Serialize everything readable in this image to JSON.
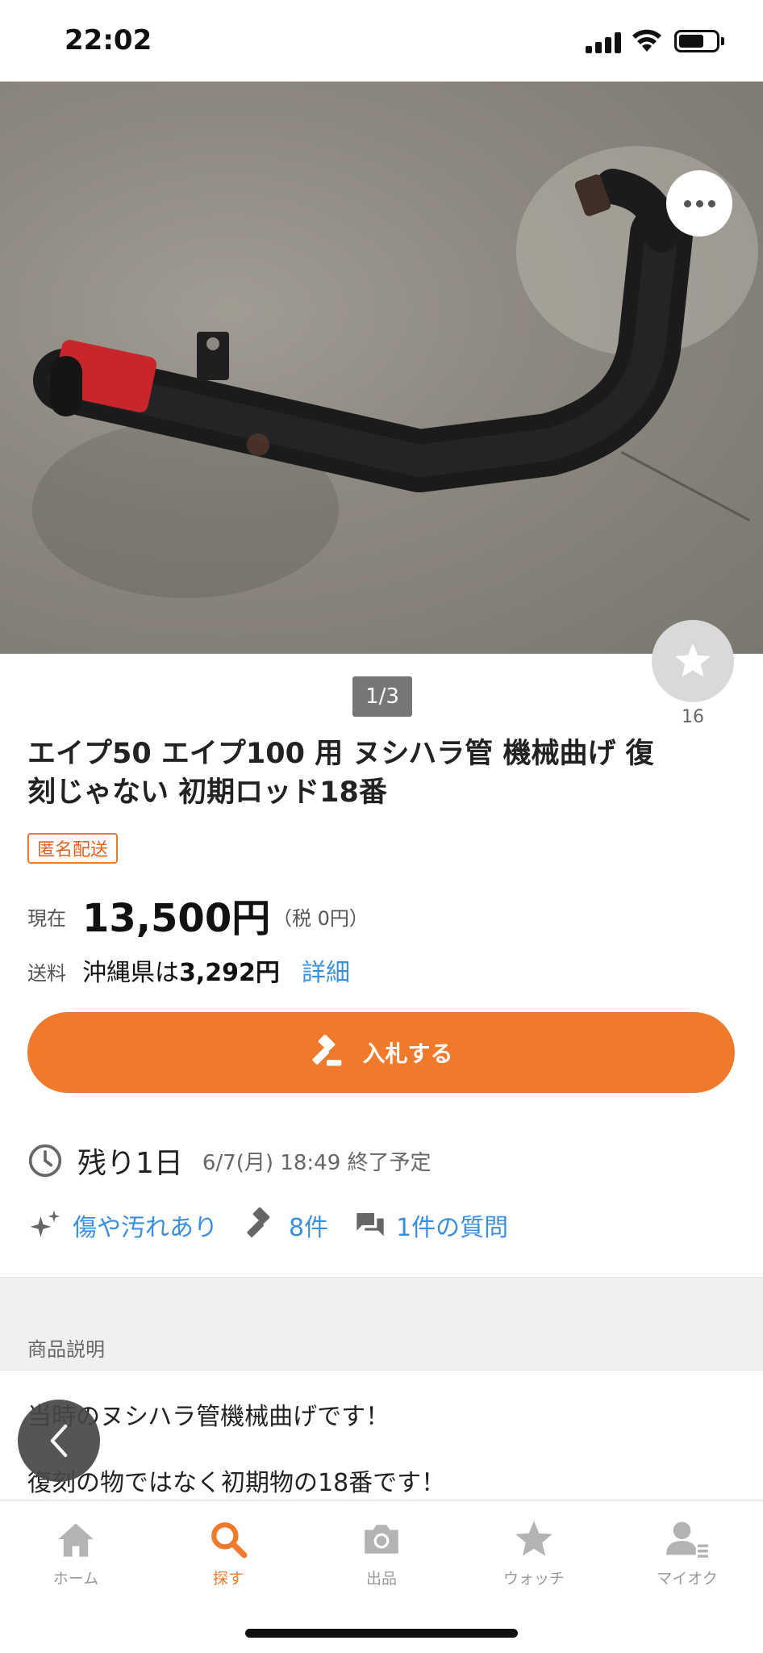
{
  "status": {
    "time": "22:02"
  },
  "photo": {
    "alt": "",
    "page_counter": "1/3"
  },
  "watch": {
    "count": "16"
  },
  "item": {
    "title": "エイプ50 エイプ100 用 ヌシハラ管 機械曲げ 復刻じゃない 初期ロッド18番",
    "badge": "匿名配送",
    "price_label": "現在",
    "price": "13,500円",
    "tax": "（税 0円）",
    "ship_label": "送料",
    "ship_prefix": "沖縄県は",
    "ship_price": "3,292円",
    "ship_detail": "詳細"
  },
  "bid_button": {
    "label": "入札する"
  },
  "remaining": {
    "text": "残り1日",
    "end": "6/7(月) 18:49 終了予定"
  },
  "info": {
    "condition": "傷や汚れあり",
    "bids": "8件",
    "questions": "1件の質問"
  },
  "description": {
    "section_title": "商品説明",
    "line1": "当時のヌシハラ管機械曲げです！",
    "line2": "復刻の物ではなく初期物の18番です！"
  },
  "tabs": [
    {
      "label": "ホーム",
      "icon": "home-icon"
    },
    {
      "label": "探す",
      "icon": "search-icon"
    },
    {
      "label": "出品",
      "icon": "camera-icon"
    },
    {
      "label": "ウォッチ",
      "icon": "star-icon"
    },
    {
      "label": "マイオク",
      "icon": "user-icon"
    }
  ],
  "colors": {
    "accent": "#f0792c",
    "link": "#3a8fde",
    "active_tab": "#f0792c"
  }
}
